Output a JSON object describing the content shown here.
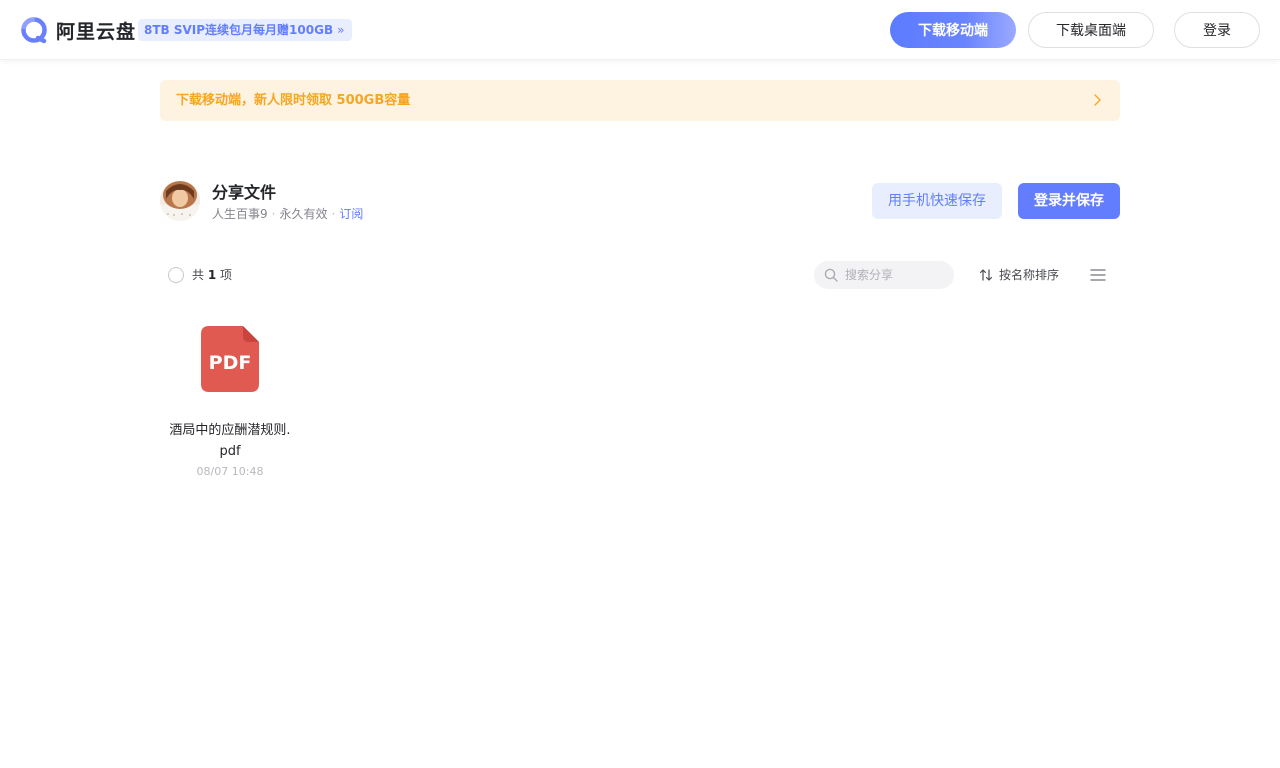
{
  "header": {
    "brand": "阿里云盘",
    "promo": "8TB SVIP连续包月每月赠100GB",
    "promo_chevron": "»",
    "download_mobile": "下载移动端",
    "download_desktop": "下载桌面端",
    "login": "登录"
  },
  "banner": {
    "text": "下载移动端，新人限时领取 500GB容量"
  },
  "share": {
    "title": "分享文件",
    "owner": "人生百事9",
    "validity": "永久有效",
    "subscribe": "订阅",
    "separator": "·",
    "quick_save": "用手机快速保存",
    "login_save": "登录并保存"
  },
  "toolbar": {
    "count_prefix": "共",
    "count": "1",
    "count_suffix": "项",
    "search_placeholder": "搜索分享",
    "sort_label": "按名称排序"
  },
  "files": [
    {
      "name": "酒局中的应酬潜规则.pdf",
      "time": "08/07 10:48",
      "type_label": "PDF"
    }
  ],
  "colors": {
    "accent": "#637dff",
    "banner_bg": "#fef2e0",
    "banner_text": "#f5a623",
    "pdf_red": "#e05a52"
  },
  "icons": {
    "logo": "aliyun-drive-logo",
    "banner_chevron": "chevron-right-icon",
    "search": "search-icon",
    "sort": "sort-arrows-icon",
    "view": "list-view-icon",
    "file": "pdf-file-icon"
  }
}
